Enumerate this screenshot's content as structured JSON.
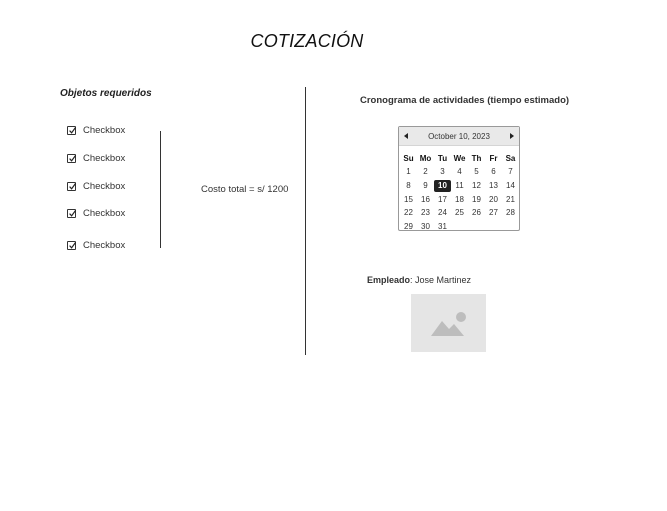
{
  "title": "COTIZACIÓN",
  "objects_label": "Objetos requeridos",
  "checkboxes": [
    {
      "label": "Checkbox",
      "checked": true
    },
    {
      "label": "Checkbox",
      "checked": true
    },
    {
      "label": "Checkbox",
      "checked": true
    },
    {
      "label": "Checkbox",
      "checked": true
    },
    {
      "label": "Checkbox",
      "checked": true
    }
  ],
  "total_text": "Costo total = s/ 1200",
  "schedule_label": "Cronograma de actividades (tiempo estimado)",
  "calendar": {
    "month_label": "October 10, 2023",
    "weekdays": [
      "Su",
      "Mo",
      "Tu",
      "We",
      "Th",
      "Fr",
      "Sa"
    ],
    "selected_day": "10",
    "weeks": [
      [
        "1",
        "2",
        "3",
        "4",
        "5",
        "6",
        "7"
      ],
      [
        "8",
        "9",
        "10",
        "11",
        "12",
        "13",
        "14"
      ],
      [
        "15",
        "16",
        "17",
        "18",
        "19",
        "20",
        "21"
      ],
      [
        "22",
        "23",
        "24",
        "25",
        "26",
        "27",
        "28"
      ],
      [
        "29",
        "30",
        "31",
        "",
        "",
        "",
        ""
      ]
    ]
  },
  "employee": {
    "label": "Empleado",
    "separator": ": ",
    "name": "Jose Martinez"
  },
  "icons": {
    "check": "check-icon",
    "image_placeholder": "image-placeholder-icon",
    "prev": "chevron-left-icon",
    "next": "chevron-right-icon"
  }
}
